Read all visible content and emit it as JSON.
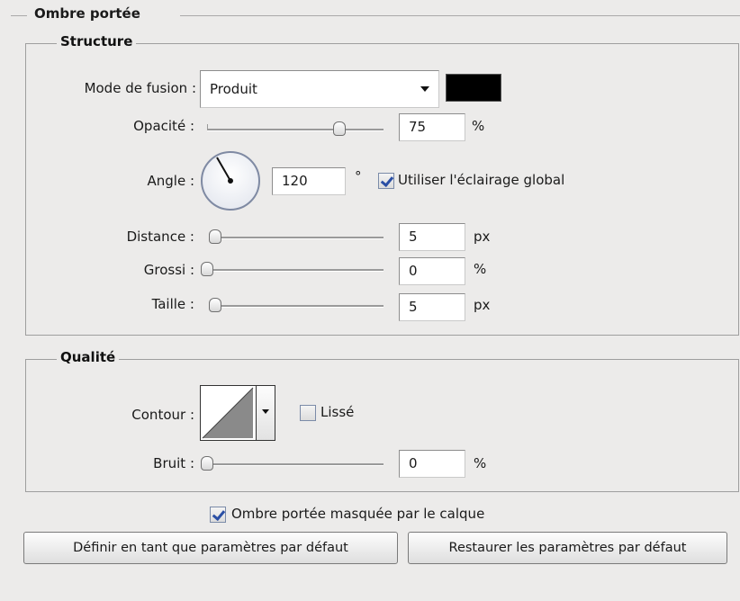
{
  "section": {
    "title": "Ombre portée"
  },
  "structure": {
    "title": "Structure",
    "blend_mode": {
      "label": "Mode de fusion :",
      "value": "Produit",
      "swatch_color": "#000000"
    },
    "opacity": {
      "label": "Opacité :",
      "value": "75",
      "unit": "%",
      "level": 0.75
    },
    "angle": {
      "label": "Angle :",
      "value": "120",
      "unit": "°",
      "degrees": 120,
      "use_global_label": "Utiliser l'éclairage global",
      "use_global_checked": true
    },
    "distance": {
      "label": "Distance :",
      "value": "5",
      "unit": "px",
      "level": 0.02
    },
    "spread": {
      "label": "Grossi :",
      "value": "0",
      "unit": "%",
      "level": 0
    },
    "size": {
      "label": "Taille :",
      "value": "5",
      "unit": "px",
      "level": 0.02
    }
  },
  "quality": {
    "title": "Qualité",
    "contour": {
      "label": "Contour :",
      "antialias_label": "Lissé",
      "antialias_checked": false
    },
    "noise": {
      "label": "Bruit :",
      "value": "0",
      "unit": "%",
      "level": 0
    }
  },
  "knockout": {
    "label": "Ombre portée masquée par le calque",
    "checked": true
  },
  "buttons": {
    "set_default": "Définir en tant que paramètres par défaut",
    "reset_default": "Restaurer les paramètres par défaut"
  },
  "colors": {
    "background": "#ecebea",
    "check_mark": "#2a4fa5",
    "swatch": "#000000"
  }
}
